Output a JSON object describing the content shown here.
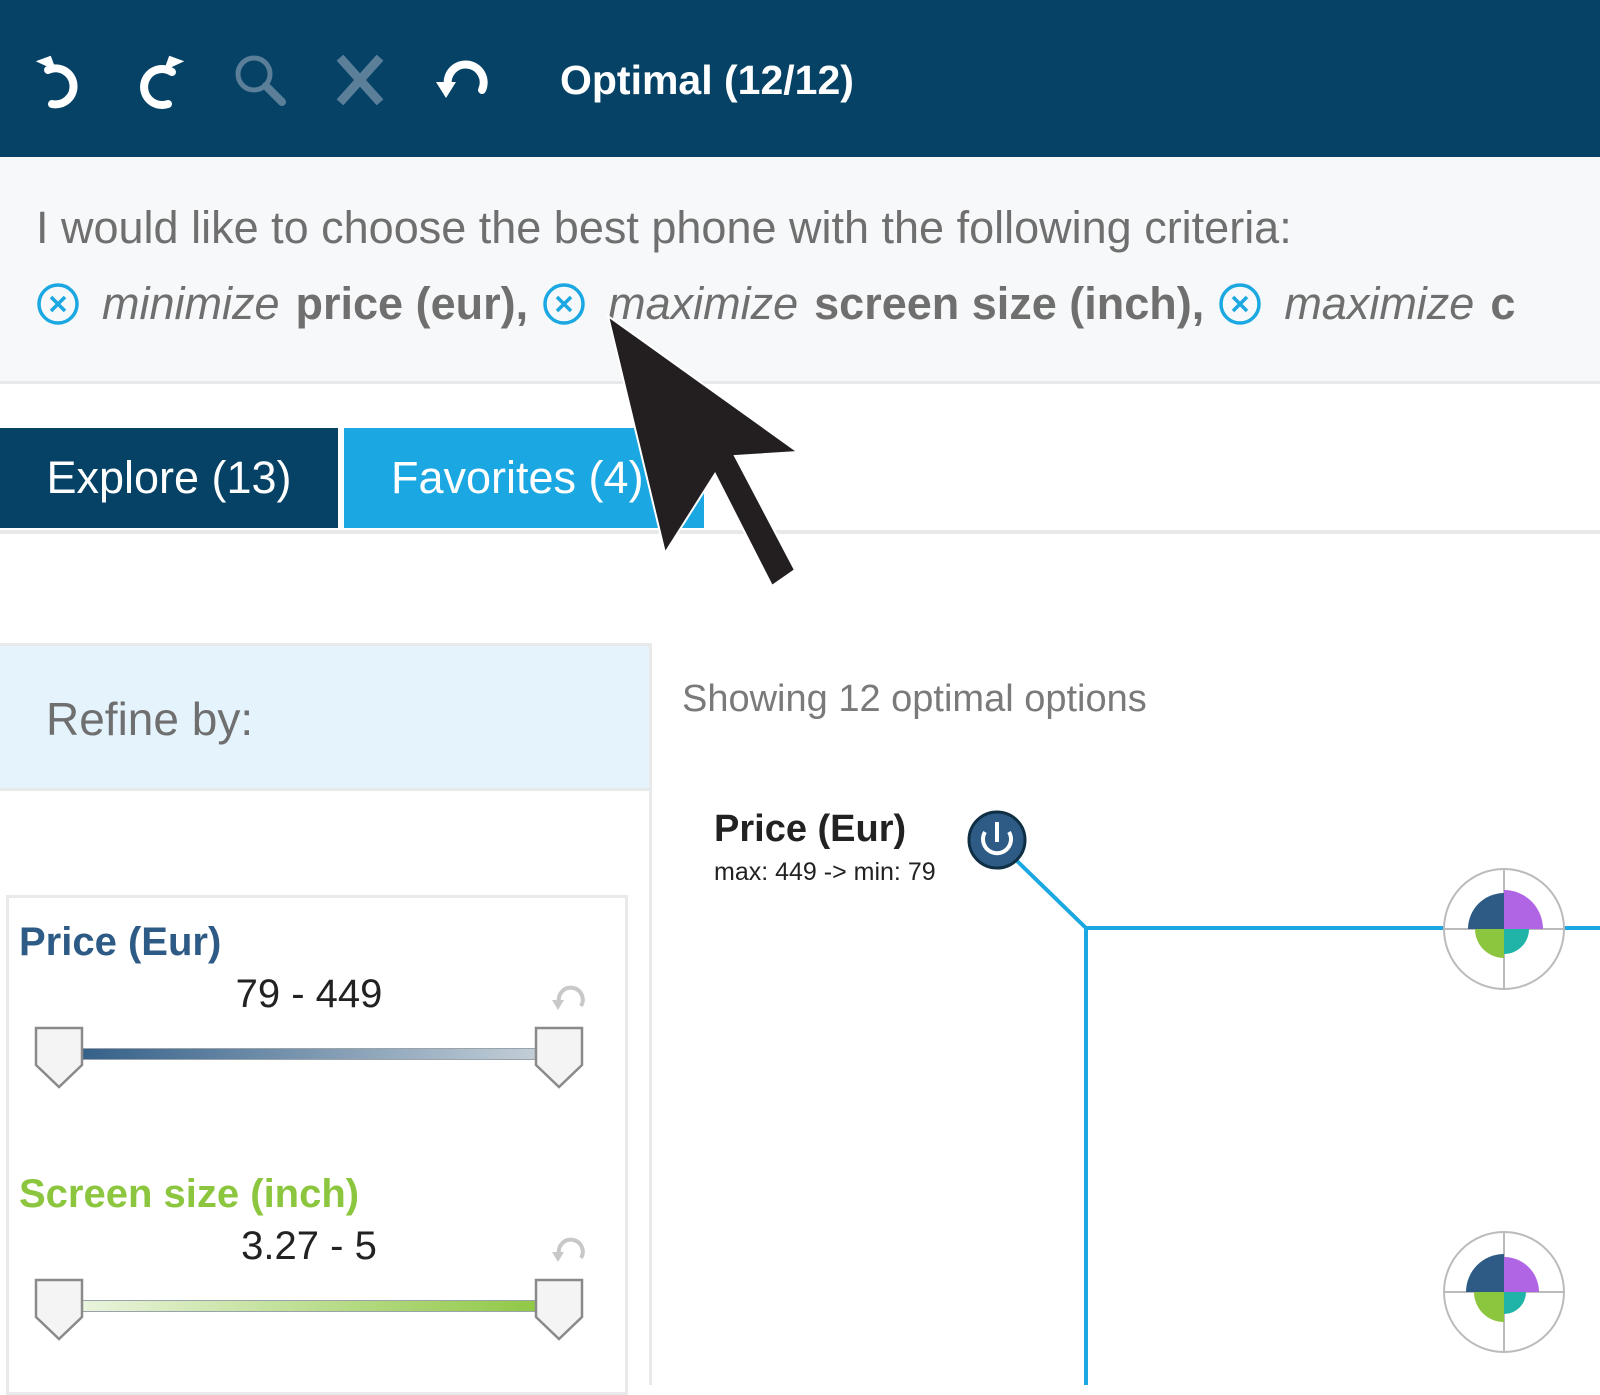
{
  "toolbar": {
    "title": "Optimal (12/12)",
    "buttons": [
      {
        "icon": "undo-icon"
      },
      {
        "icon": "redo-icon"
      },
      {
        "icon": "search-icon",
        "enabled": false
      },
      {
        "icon": "close-x-icon",
        "enabled": false
      },
      {
        "icon": "reset-icon"
      }
    ]
  },
  "criteria": {
    "intro": "I would like to choose the best phone with the following criteria:",
    "items": [
      {
        "verb": "minimize",
        "attribute": "price (eur)",
        "separator": ","
      },
      {
        "verb": "maximize",
        "attribute": "screen size (inch)",
        "separator": ","
      },
      {
        "verb": "maximize",
        "attribute": "c",
        "separator": ""
      }
    ]
  },
  "tabs": {
    "explore": "Explore (13)",
    "favorites": "Favorites (4)"
  },
  "refine": {
    "label": "Refine by:",
    "filters": [
      {
        "name": "Price (Eur)",
        "range": "79 - 449",
        "color": "#2e5b85",
        "min_fraction": 0.0,
        "max_fraction": 1.0
      },
      {
        "name": "Screen size (inch)",
        "range": "3.27 - 5",
        "color": "#8cc63f",
        "min_fraction": 0.0,
        "max_fraction": 1.0
      }
    ]
  },
  "graph": {
    "caption": "Showing 12 optimal options",
    "axis_name": "Price (Eur)",
    "axis_range": "max: 449 -> min: 79",
    "line_color": "#1ba8e2"
  },
  "colors": {
    "toolbar_bg": "#054265",
    "tab_active": "#054265",
    "tab_fav": "#1ba8e2",
    "accent": "#1ba8e2",
    "price": "#2e5b85",
    "screen": "#8cc63f"
  }
}
